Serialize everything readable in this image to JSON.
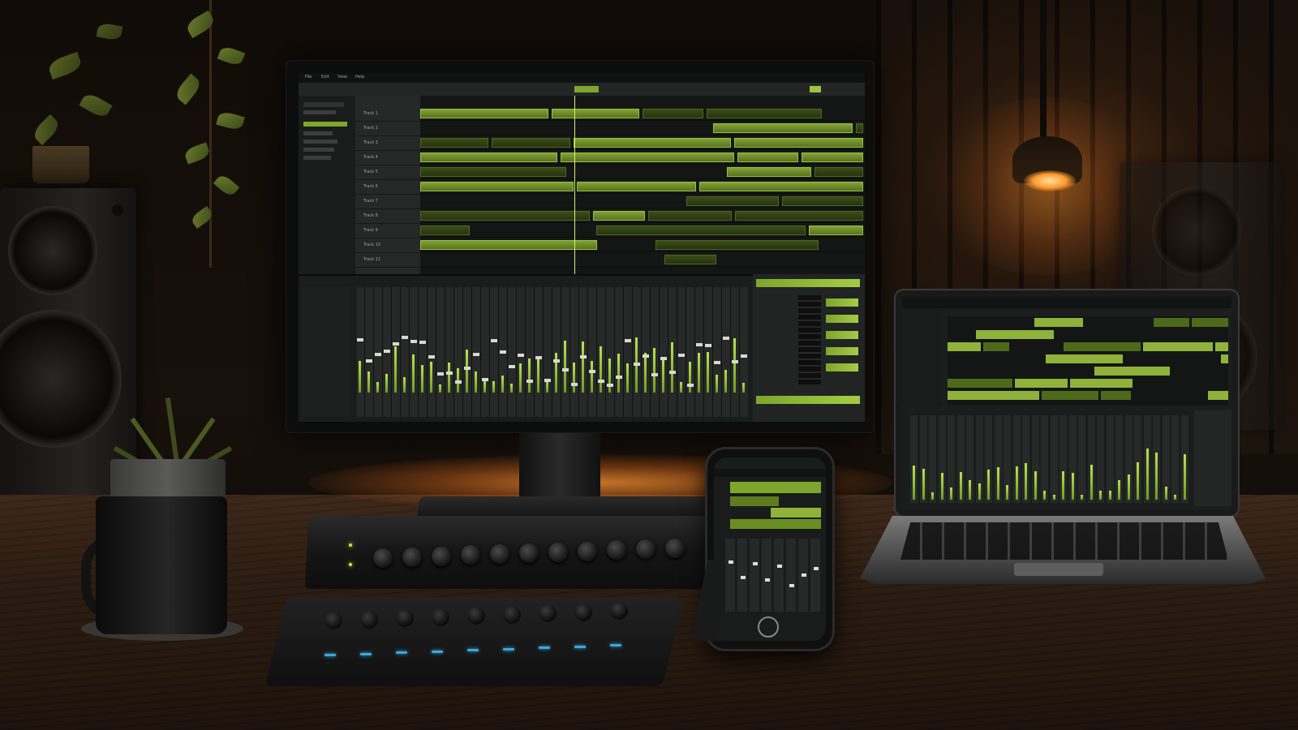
{
  "scene": {
    "subject": "music production studio with DAW software on multiple devices",
    "accent_color": "#9bc53d",
    "ambient_color": "#ff9b30"
  },
  "monitor_daw": {
    "menu_items": [
      "File",
      "Edit",
      "View",
      "Help"
    ],
    "track_names": [
      "Track 1",
      "Track 2",
      "Track 3",
      "Track 4",
      "Track 5",
      "Track 6",
      "Track 7",
      "Track 8",
      "Track 9",
      "Track 10",
      "Track 11"
    ],
    "mixer_channel_count": 44
  },
  "devices": [
    "monitor",
    "laptop",
    "phone",
    "audio-interface",
    "midi-controller"
  ]
}
